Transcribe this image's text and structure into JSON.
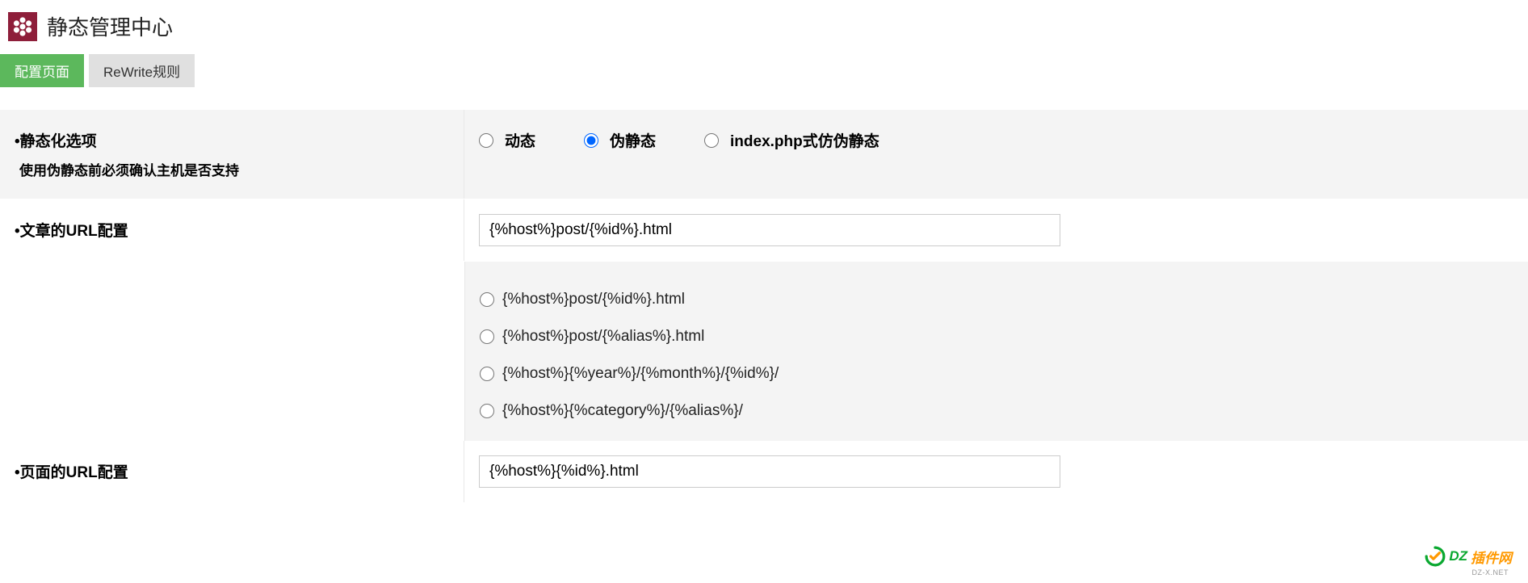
{
  "header": {
    "title": "静态管理中心"
  },
  "tabs": {
    "config": "配置页面",
    "rewrite": "ReWrite规则"
  },
  "sections": {
    "static_option": {
      "label": "•静态化选项",
      "sublabel": "使用伪静态前必须确认主机是否支持",
      "radios": {
        "dynamic": "动态",
        "pseudo": "伪静态",
        "indexphp": "index.php式仿伪静态"
      }
    },
    "article_url": {
      "label": "•文章的URL配置",
      "value": "{%host%}post/{%id%}.html",
      "options": [
        "{%host%}post/{%id%}.html",
        "{%host%}post/{%alias%}.html",
        "{%host%}{%year%}/{%month%}/{%id%}/",
        "{%host%}{%category%}/{%alias%}/"
      ]
    },
    "page_url": {
      "label": "•页面的URL配置",
      "value": "{%host%}{%id%}.html"
    }
  },
  "watermark": {
    "dz": "DZ",
    "text": "插件网",
    "sub": "DZ-X.NET"
  }
}
